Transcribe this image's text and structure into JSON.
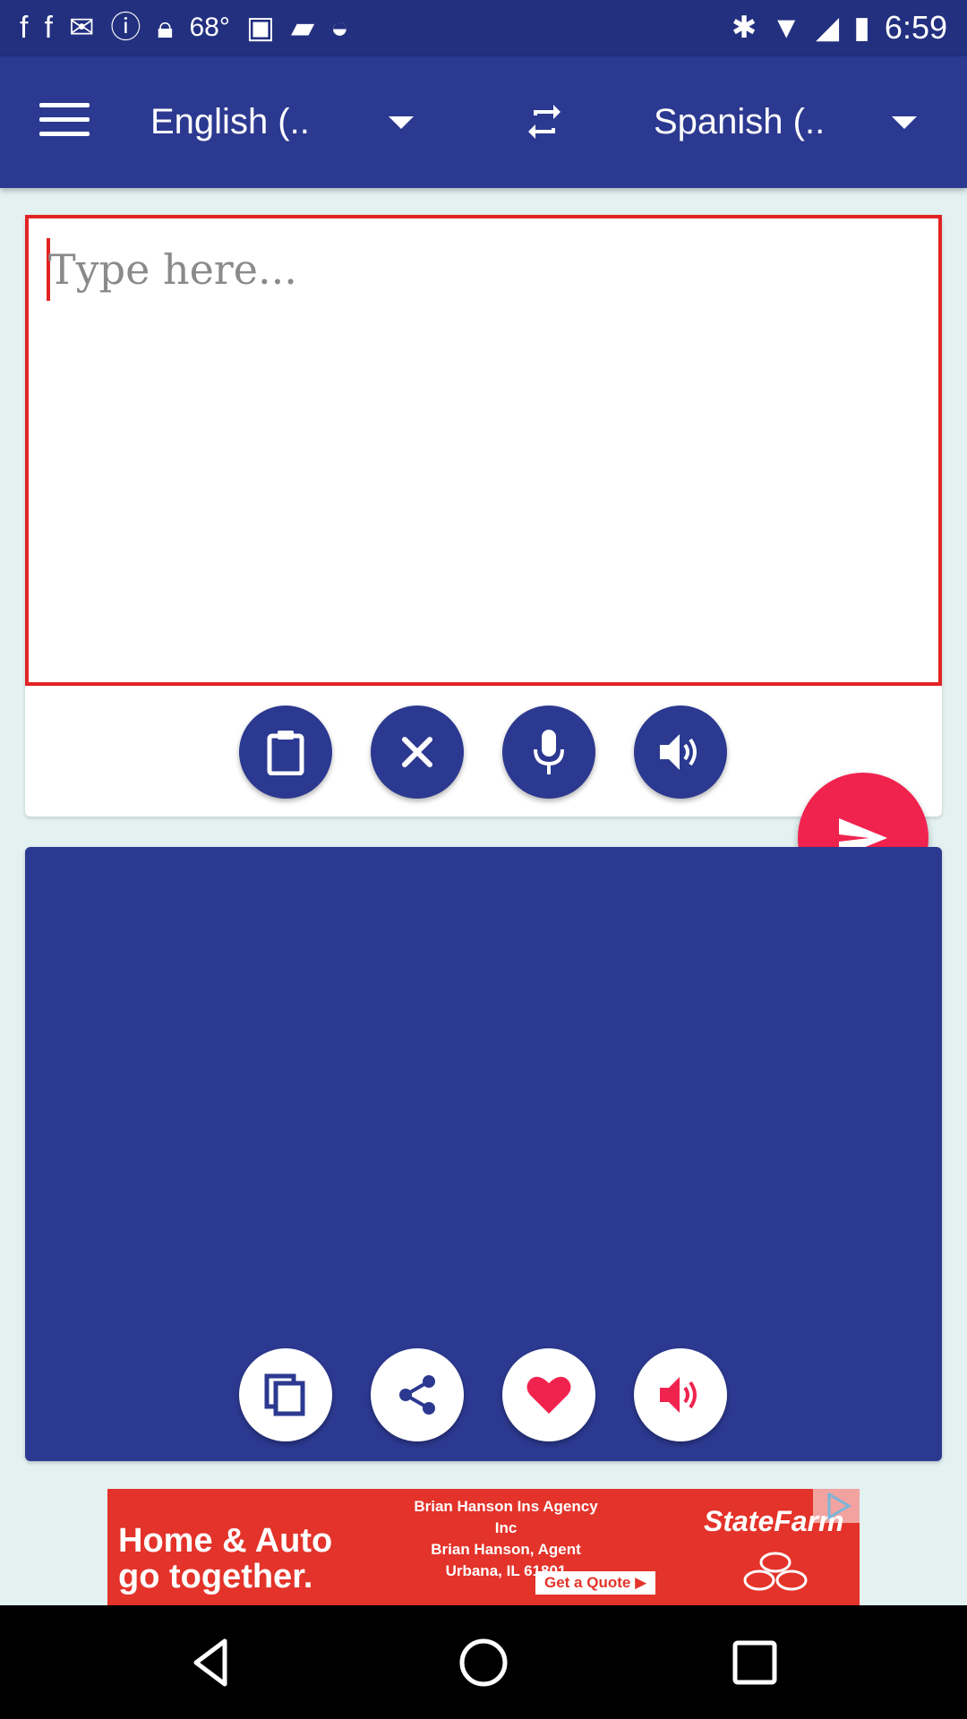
{
  "status_bar": {
    "temperature": "68°",
    "time": "6:59"
  },
  "app_bar": {
    "source_language": "English (..",
    "target_language": "Spanish (.."
  },
  "input": {
    "placeholder": "Type here..."
  },
  "ad": {
    "headline_line1": "Home & Auto",
    "headline_line2": "go together.",
    "agency_line1": "Brian Hanson Ins Agency Inc",
    "agency_line2": "Brian Hanson, Agent",
    "agency_line3": "Urbana, IL 61801",
    "cta": "Get a Quote",
    "brand": "StateFarm"
  },
  "colors": {
    "primary": "#2c3990",
    "status_bar": "#22307f",
    "accent": "#f0234f",
    "input_border": "#e22323",
    "background": "#e3f1f1"
  }
}
